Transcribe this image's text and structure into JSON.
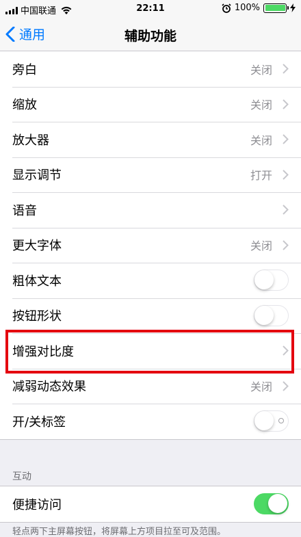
{
  "status_bar": {
    "carrier": "中国联通",
    "time": "22:11",
    "battery": "100%"
  },
  "nav": {
    "back_label": "通用",
    "title": "辅助功能"
  },
  "settings": [
    {
      "label": "旁白",
      "detail": "关闭",
      "control": "chevron"
    },
    {
      "label": "缩放",
      "detail": "关闭",
      "control": "chevron"
    },
    {
      "label": "放大器",
      "detail": "关闭",
      "control": "chevron"
    },
    {
      "label": "显示调节",
      "detail": "打开",
      "control": "chevron"
    },
    {
      "label": "语音",
      "detail": "",
      "control": "chevron"
    },
    {
      "label": "更大字体",
      "detail": "关闭",
      "control": "chevron"
    },
    {
      "label": "粗体文本",
      "control": "toggle",
      "on": false
    },
    {
      "label": "按钮形状",
      "control": "toggle",
      "on": false
    },
    {
      "label": "增强对比度",
      "detail": "",
      "control": "chevron",
      "highlighted": true
    },
    {
      "label": "减弱动态效果",
      "detail": "关闭",
      "control": "chevron"
    },
    {
      "label": "开/关标签",
      "control": "toggle",
      "on": false
    }
  ],
  "interaction_section": {
    "header": "互动",
    "item": {
      "label": "便捷访问",
      "control": "toggle",
      "on": true
    },
    "footer": "轻点两下主屏幕按钮，将屏幕上方项目拉至可及范围。"
  },
  "colors": {
    "accent": "#007aff",
    "toggle_on": "#4cd964",
    "highlight_box": "#e4000f",
    "background": "#efeff4"
  }
}
